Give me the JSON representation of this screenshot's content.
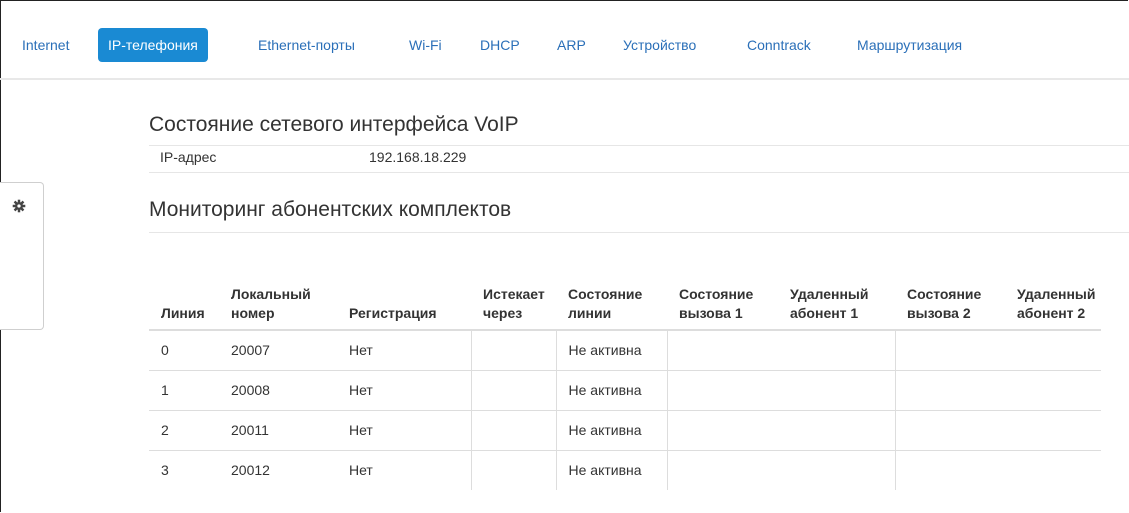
{
  "nav": {
    "items": [
      {
        "label": "Internet",
        "active": false
      },
      {
        "label": "IP-телефония",
        "active": true
      },
      {
        "label": "Ethernet-порты",
        "active": false
      },
      {
        "label": "Wi-Fi",
        "active": false
      },
      {
        "label": "DHCP",
        "active": false
      },
      {
        "label": "ARP",
        "active": false
      },
      {
        "label": "Устройство",
        "active": false
      },
      {
        "label": "Conntrack",
        "active": false
      },
      {
        "label": "Маршрутизация",
        "active": false
      }
    ]
  },
  "side_panel": {
    "icon": "gear-icon"
  },
  "voip": {
    "title": "Состояние сетевого интерфейса VoIP",
    "ip_label": "IP-адрес",
    "ip_value": "192.168.18.229"
  },
  "monitoring": {
    "title": "Мониторинг абонентских комплектов",
    "columns": [
      [
        "Линия"
      ],
      [
        "Локальный",
        "номер"
      ],
      [
        "Регистрация"
      ],
      [
        "Истекает",
        "через"
      ],
      [
        "Состояние",
        "линии"
      ],
      [
        "Состояние",
        "вызова 1"
      ],
      [
        "Удаленный",
        "абонент 1"
      ],
      [
        "Состояние",
        "вызова 2"
      ],
      [
        "Удаленный",
        "абонент 2"
      ]
    ],
    "rows": [
      [
        "0",
        "20007",
        "Нет",
        "",
        "Не активна",
        "",
        "",
        "",
        ""
      ],
      [
        "1",
        "20008",
        "Нет",
        "",
        "Не активна",
        "",
        "",
        "",
        ""
      ],
      [
        "2",
        "20011",
        "Нет",
        "",
        "Не активна",
        "",
        "",
        "",
        ""
      ],
      [
        "3",
        "20012",
        "Нет",
        "",
        "Не активна",
        "",
        "",
        "",
        ""
      ]
    ]
  },
  "colors": {
    "accent": "#1a8ad3",
    "link": "#2a6fb8"
  }
}
